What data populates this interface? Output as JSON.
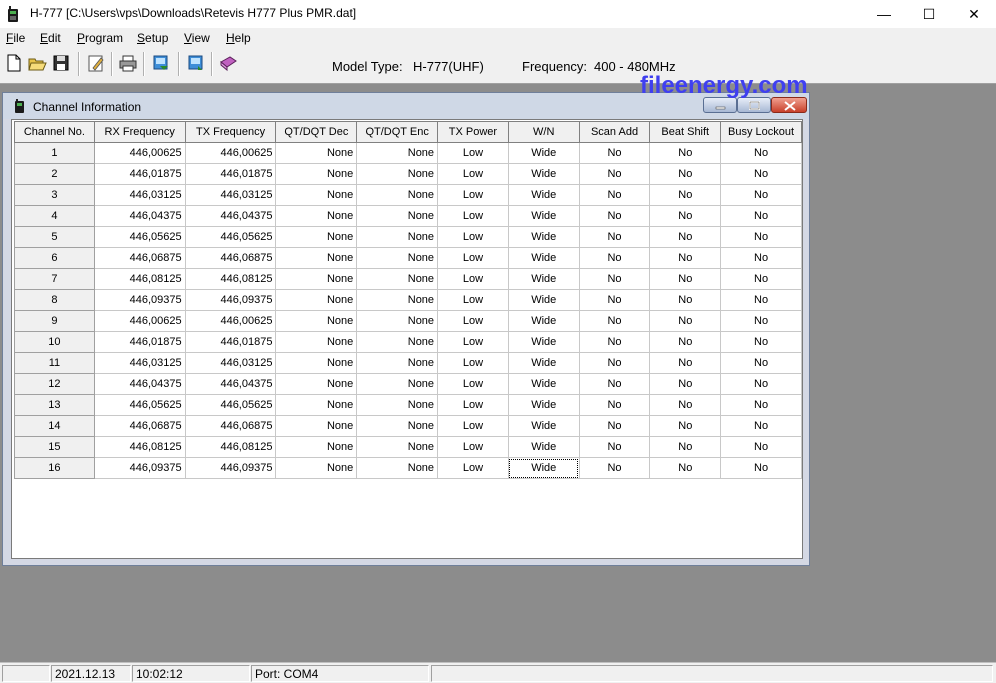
{
  "window": {
    "title": "H-777 [C:\\Users\\vps\\Downloads\\Retevis H777 Plus PMR.dat]",
    "min_glyph": "—",
    "max_glyph": "☐",
    "close_glyph": "✕"
  },
  "menu": [
    {
      "label": "File",
      "accel": "F"
    },
    {
      "label": "Edit",
      "accel": "E"
    },
    {
      "label": "Program",
      "accel": "P"
    },
    {
      "label": "Setup",
      "accel": "S"
    },
    {
      "label": "View",
      "accel": "V"
    },
    {
      "label": "Help",
      "accel": "H"
    }
  ],
  "toolbar": {
    "buttons": [
      "new-icon",
      "open-icon",
      "save-icon",
      "edit-icon",
      "print-icon",
      "read-radio-icon",
      "write-radio-icon",
      "book-icon"
    ]
  },
  "info": {
    "model_label": "Model Type:",
    "model_value": "H-777(UHF)",
    "frequency_label": "Frequency:",
    "frequency_value": "400 - 480MHz"
  },
  "watermark": "fileenergy.com",
  "child": {
    "title": "Channel Information"
  },
  "table": {
    "headers": [
      "Channel No.",
      "RX Frequency",
      "TX Frequency",
      "QT/DQT Dec",
      "QT/DQT Enc",
      "TX Power",
      "W/N",
      "Scan Add",
      "Beat Shift",
      "Busy Lockout"
    ],
    "rows": [
      [
        "1",
        "446,00625",
        "446,00625",
        "None",
        "None",
        "Low",
        "Wide",
        "No",
        "No",
        "No"
      ],
      [
        "2",
        "446,01875",
        "446,01875",
        "None",
        "None",
        "Low",
        "Wide",
        "No",
        "No",
        "No"
      ],
      [
        "3",
        "446,03125",
        "446,03125",
        "None",
        "None",
        "Low",
        "Wide",
        "No",
        "No",
        "No"
      ],
      [
        "4",
        "446,04375",
        "446,04375",
        "None",
        "None",
        "Low",
        "Wide",
        "No",
        "No",
        "No"
      ],
      [
        "5",
        "446,05625",
        "446,05625",
        "None",
        "None",
        "Low",
        "Wide",
        "No",
        "No",
        "No"
      ],
      [
        "6",
        "446,06875",
        "446,06875",
        "None",
        "None",
        "Low",
        "Wide",
        "No",
        "No",
        "No"
      ],
      [
        "7",
        "446,08125",
        "446,08125",
        "None",
        "None",
        "Low",
        "Wide",
        "No",
        "No",
        "No"
      ],
      [
        "8",
        "446,09375",
        "446,09375",
        "None",
        "None",
        "Low",
        "Wide",
        "No",
        "No",
        "No"
      ],
      [
        "9",
        "446,00625",
        "446,00625",
        "None",
        "None",
        "Low",
        "Wide",
        "No",
        "No",
        "No"
      ],
      [
        "10",
        "446,01875",
        "446,01875",
        "None",
        "None",
        "Low",
        "Wide",
        "No",
        "No",
        "No"
      ],
      [
        "11",
        "446,03125",
        "446,03125",
        "None",
        "None",
        "Low",
        "Wide",
        "No",
        "No",
        "No"
      ],
      [
        "12",
        "446,04375",
        "446,04375",
        "None",
        "None",
        "Low",
        "Wide",
        "No",
        "No",
        "No"
      ],
      [
        "13",
        "446,05625",
        "446,05625",
        "None",
        "None",
        "Low",
        "Wide",
        "No",
        "No",
        "No"
      ],
      [
        "14",
        "446,06875",
        "446,06875",
        "None",
        "None",
        "Low",
        "Wide",
        "No",
        "No",
        "No"
      ],
      [
        "15",
        "446,08125",
        "446,08125",
        "None",
        "None",
        "Low",
        "Wide",
        "No",
        "No",
        "No"
      ],
      [
        "16",
        "446,09375",
        "446,09375",
        "None",
        "None",
        "Low",
        "Wide",
        "No",
        "No",
        "No"
      ]
    ]
  },
  "status": {
    "date": "2021.12.13",
    "time": "10:02:12",
    "port": "Port: COM4"
  },
  "colors": {
    "watermark": "#3f3ff0",
    "mdi_background": "#8c8c8c",
    "close_button": "#c8402a"
  }
}
